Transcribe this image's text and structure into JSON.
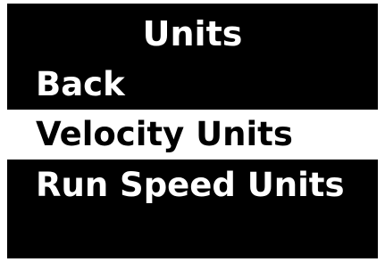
{
  "screen": {
    "title": "Units",
    "items": [
      {
        "label": "Back",
        "selected": false
      },
      {
        "label": "Velocity Units",
        "selected": true
      },
      {
        "label": "Run Speed Units",
        "selected": false
      }
    ]
  },
  "colors": {
    "background": "#000000",
    "text": "#ffffff",
    "selected_background": "#ffffff",
    "selected_text": "#000000"
  }
}
